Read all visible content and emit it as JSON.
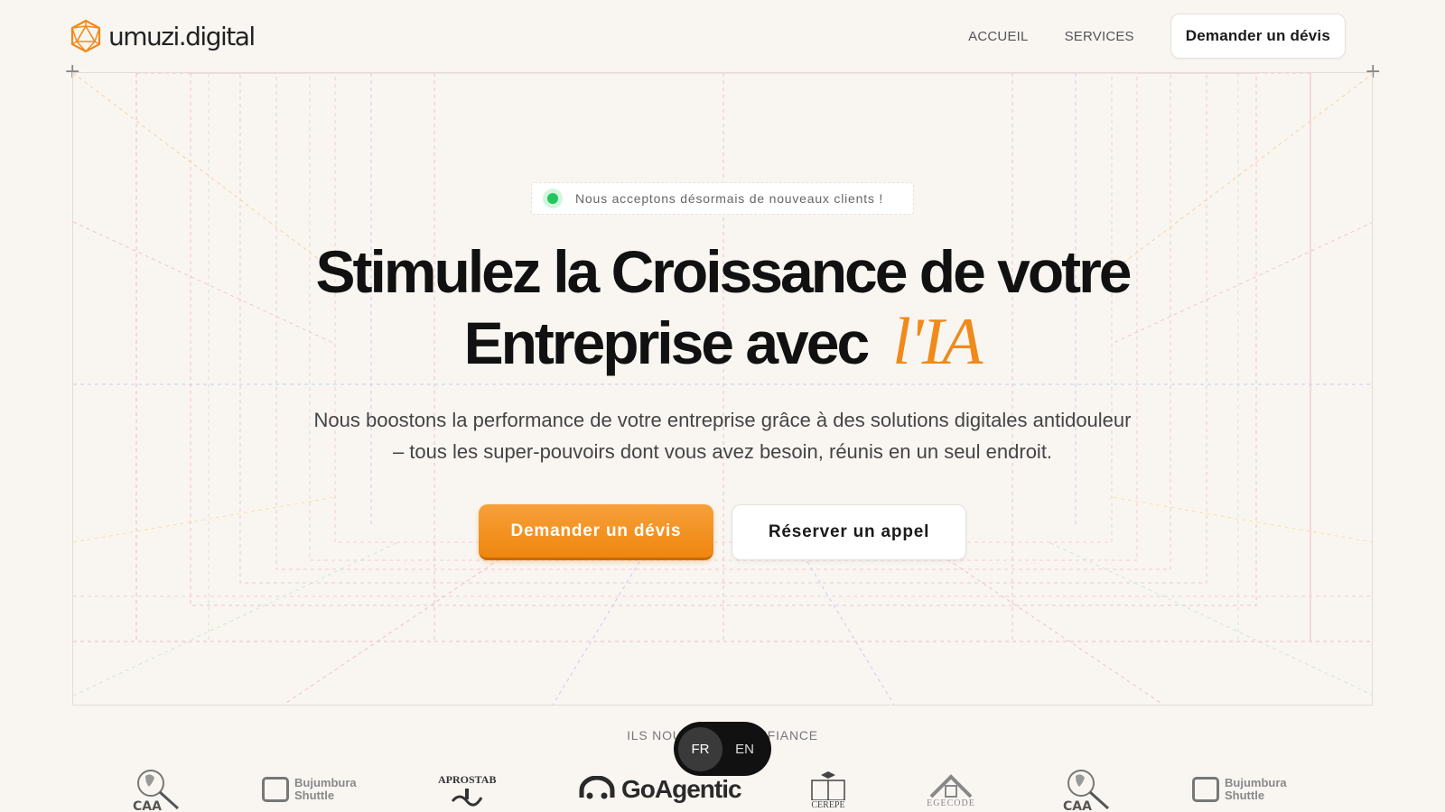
{
  "header": {
    "brand": "umuzi.digital",
    "nav": {
      "home": "ACCUEIL",
      "services": "SERVICES",
      "cta": "Demander un dévis"
    }
  },
  "hero": {
    "badge": "Nous acceptons désormais de nouveaux clients !",
    "headline_line1": "Stimulez la Croissance de votre",
    "headline_line2": "Entreprise avec",
    "headline_accent": "l'IA",
    "subtitle": "Nous boostons la performance de votre entreprise grâce à des solutions digitales antidouleur – tous les super-pouvoirs dont vous avez besoin, réunis en un seul endroit.",
    "primary_cta": "Demander un dévis",
    "secondary_cta": "Réserver un appel"
  },
  "trust": {
    "label": "ILS NOUS FONT CONFIANCE",
    "logos": [
      {
        "name": "CAA"
      },
      {
        "name": "Bujumbura Shuttle",
        "line1": "Bujumbura",
        "line2": "Shuttle"
      },
      {
        "name": "APROSTAB"
      },
      {
        "name": "GoAgentic"
      },
      {
        "name": "CEREPE"
      },
      {
        "name": "EGECODE"
      },
      {
        "name": "CAA"
      },
      {
        "name": "Bujumbura Shuttle",
        "line1": "Bujumbura",
        "line2": "Shuttle"
      }
    ]
  },
  "language": {
    "options": [
      "FR",
      "EN"
    ],
    "active": "FR"
  },
  "colors": {
    "accent": "#f08a1a",
    "background": "#f9f6f2",
    "status_dot": "#22c55e",
    "toggle_bg": "#111111"
  }
}
